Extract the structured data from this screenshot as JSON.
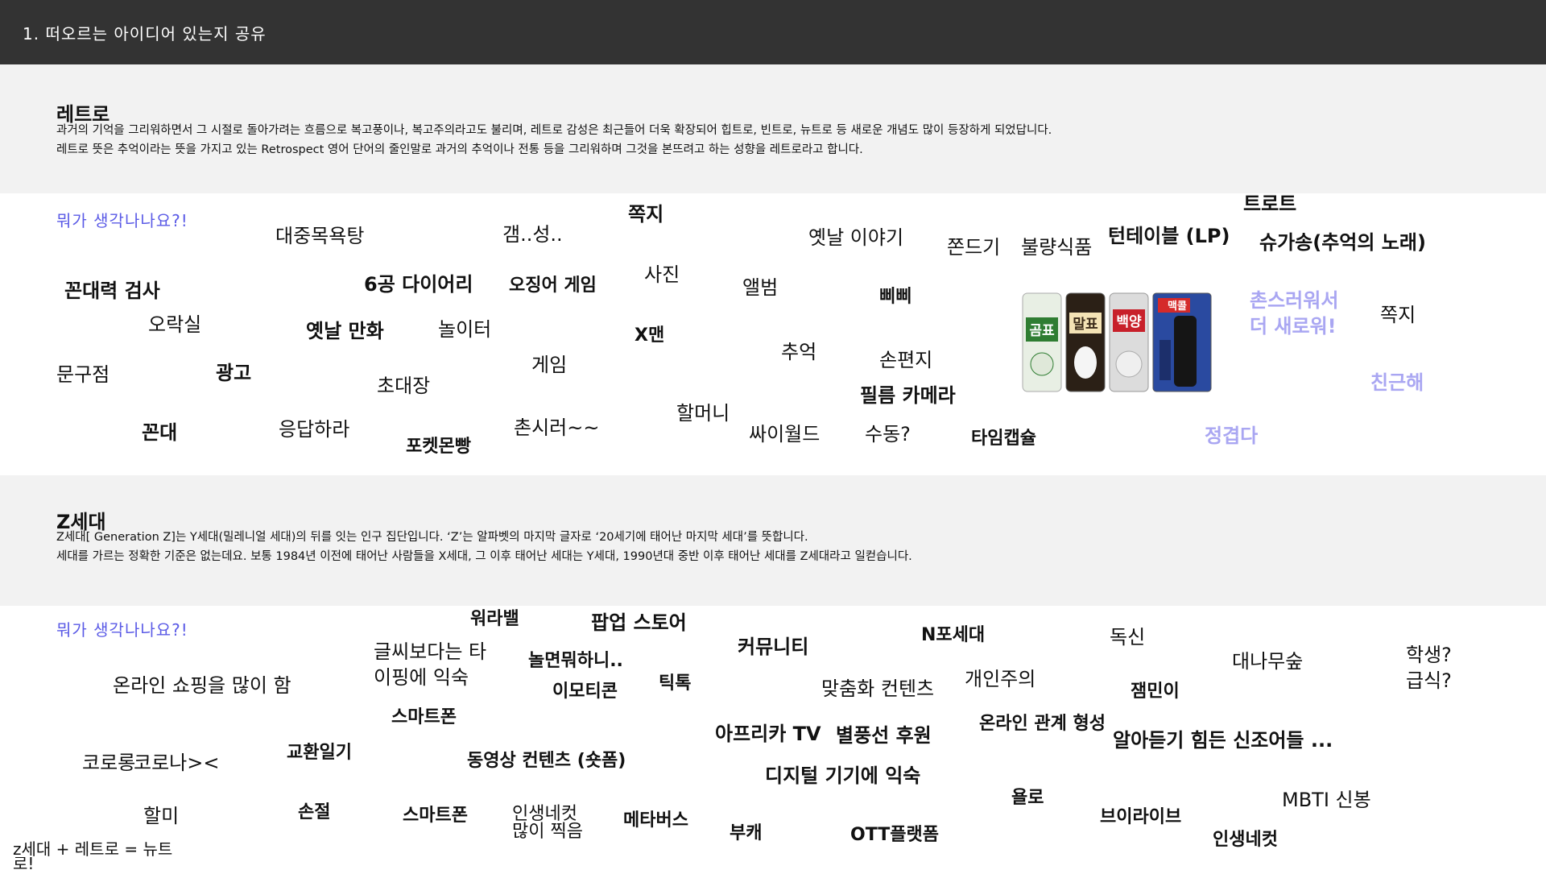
{
  "header": {
    "title": "1. 떠오르는 아이디어 있는지 공유"
  },
  "retro": {
    "title": "레트로",
    "desc1": "과거의 기억을 그리워하면서 그 시절로 돌아가려는 흐름으로 복고풍이나, 복고주의라고도 불리며, 레트로 감성은 최근들어 더욱 확장되어 힙트로, 빈트로, 뉴트로 등 새로운 개념도 많이 등장하게 되었답니다.",
    "desc2": "레트로 뜻은 추억이라는 뜻을 가지고 있는 Retrospect 영어 단어의 줄인말로 과거의 추억이나 전통 등을 그리워하며 그것을 본뜨려고 하는 성향을 레트로라고 합니다.",
    "prompt": "뭐가 생각나나요?!",
    "words": [
      "대중목욕탕",
      "갬..성..",
      "쪽지",
      "옛날 이야기",
      "쫀드기",
      "불량식품",
      "턴테이블 (LP)",
      "트로트",
      "슈가송(추억의 노래)",
      "꼰대력 검사",
      "6공 다이어리",
      "오징어 게임",
      "사진",
      "앨범",
      "삐삐",
      "오락실",
      "옛날 만화",
      "놀이터",
      "X맨",
      "추억",
      "손편지",
      "문구점",
      "광고",
      "초대장",
      "게임",
      "필름 카메라",
      "꼰대",
      "응답하라",
      "포켓몬빵",
      "촌시러~~",
      "할머니",
      "싸이월드",
      "수동?",
      "타임캡슐",
      "쪽지"
    ],
    "lavender": [
      "촌스러워서",
      "더 새로워!",
      "친근해",
      "정겹다"
    ],
    "cans": [
      "곰표",
      "말표",
      "백양",
      "맥콜"
    ]
  },
  "genz": {
    "title": "Z세대",
    "desc1": "Z세대[ Generation Z]는 Y세대(밀레니얼 세대)의 뒤를 잇는 인구 집단입니다. ‘Z’는 알파벳의 마지막 글자로 ‘20세기에 태어난 마지막 세대’를 뜻합니다.",
    "desc2": "세대를 가르는 정확한 기준은 없는데요. 보통 1984년 이전에 태어난 사람들을 X세대, 그 이후 태어난 세대는 Y세대, 1990년대 중반 이후 태어난 세대를 Z세대라고 일컫습니다.",
    "prompt": "뭐가 생각나나요?!",
    "words": [
      "워라밸",
      "팝업 스토어",
      "글씨보다는 타",
      "이핑에 익숙",
      "놀면뭐하니..",
      "커뮤니티",
      "N포세대",
      "독신",
      "대나무숲",
      "학생?",
      "급식?",
      "온라인 쇼핑을 많이 함",
      "이모티콘",
      "틱톡",
      "맞춤화 컨텐츠",
      "개인주의",
      "잼민이",
      "스마트폰",
      "아프리카 TV",
      "별풍선 후원",
      "온라인 관계 형성",
      "알아듣기 힘든 신조어들 ...",
      "코로롱",
      "코로나><",
      "교환일기",
      "동영상 컨텐츠 (숏폼)",
      "디지털 기기에 익숙",
      "욜로",
      "MBTI 신봉",
      "할미",
      "손절",
      "스마트폰",
      "인생네컷",
      "많이 찍음",
      "메타버스",
      "부캐",
      "OTT플랫폼",
      "브이라이브",
      "인생네컷",
      "z세대 + 레트로 = 뉴트",
      "로!"
    ]
  },
  "colors": {
    "topbar": "#333333",
    "band": "#f2f2f2",
    "prompt": "#5a5ae6",
    "lavender": "#a9a6f2"
  }
}
